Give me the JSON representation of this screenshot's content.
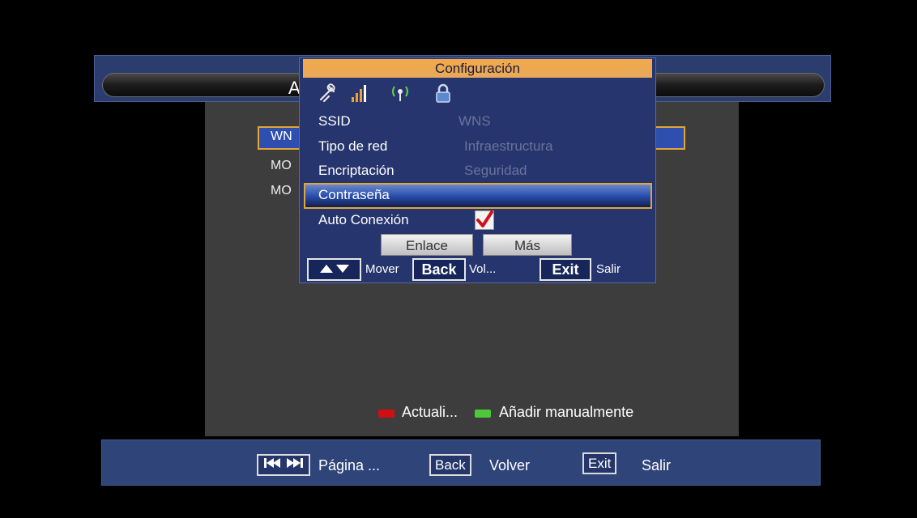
{
  "screen": {
    "title_fragment": "A",
    "list": {
      "selected": "WN",
      "items": [
        "MO",
        "MO"
      ]
    },
    "legend": {
      "red_label": "Actuali...",
      "green_label": "Añadir manualmente"
    },
    "footer": {
      "page_key": "⏮⏭",
      "page_label": "Página ...",
      "back_key": "Back",
      "back_label": "Volver",
      "exit_key": "Exit",
      "exit_label": "Salir"
    }
  },
  "dialog": {
    "title": "Configuración",
    "status_icons": [
      "link-icon",
      "signal-bars-icon",
      "wifi-antenna-icon",
      "lock-icon"
    ],
    "rows": [
      {
        "label": "SSID",
        "value": "WNS"
      },
      {
        "label": "Tipo de red",
        "value": "Infraestructura"
      },
      {
        "label": "Encriptación",
        "value": "Seguridad"
      },
      {
        "label": "Contraseña",
        "value": ""
      },
      {
        "label": "Auto Conexión",
        "checked": true
      }
    ],
    "buttons": {
      "link": "Enlace",
      "more": "Más"
    },
    "help": {
      "move_key": "▲▼",
      "move_label": "Mover",
      "back_key": "Back",
      "back_label": "Vol...",
      "exit_key": "Exit",
      "exit_label": "Salir"
    }
  },
  "colors": {
    "dialog_bg": "#26356d",
    "title_bar": "#f1a94b",
    "selection_border": "#e1a63a",
    "legend_red": "#d10f12",
    "legend_green": "#4dc83a"
  }
}
